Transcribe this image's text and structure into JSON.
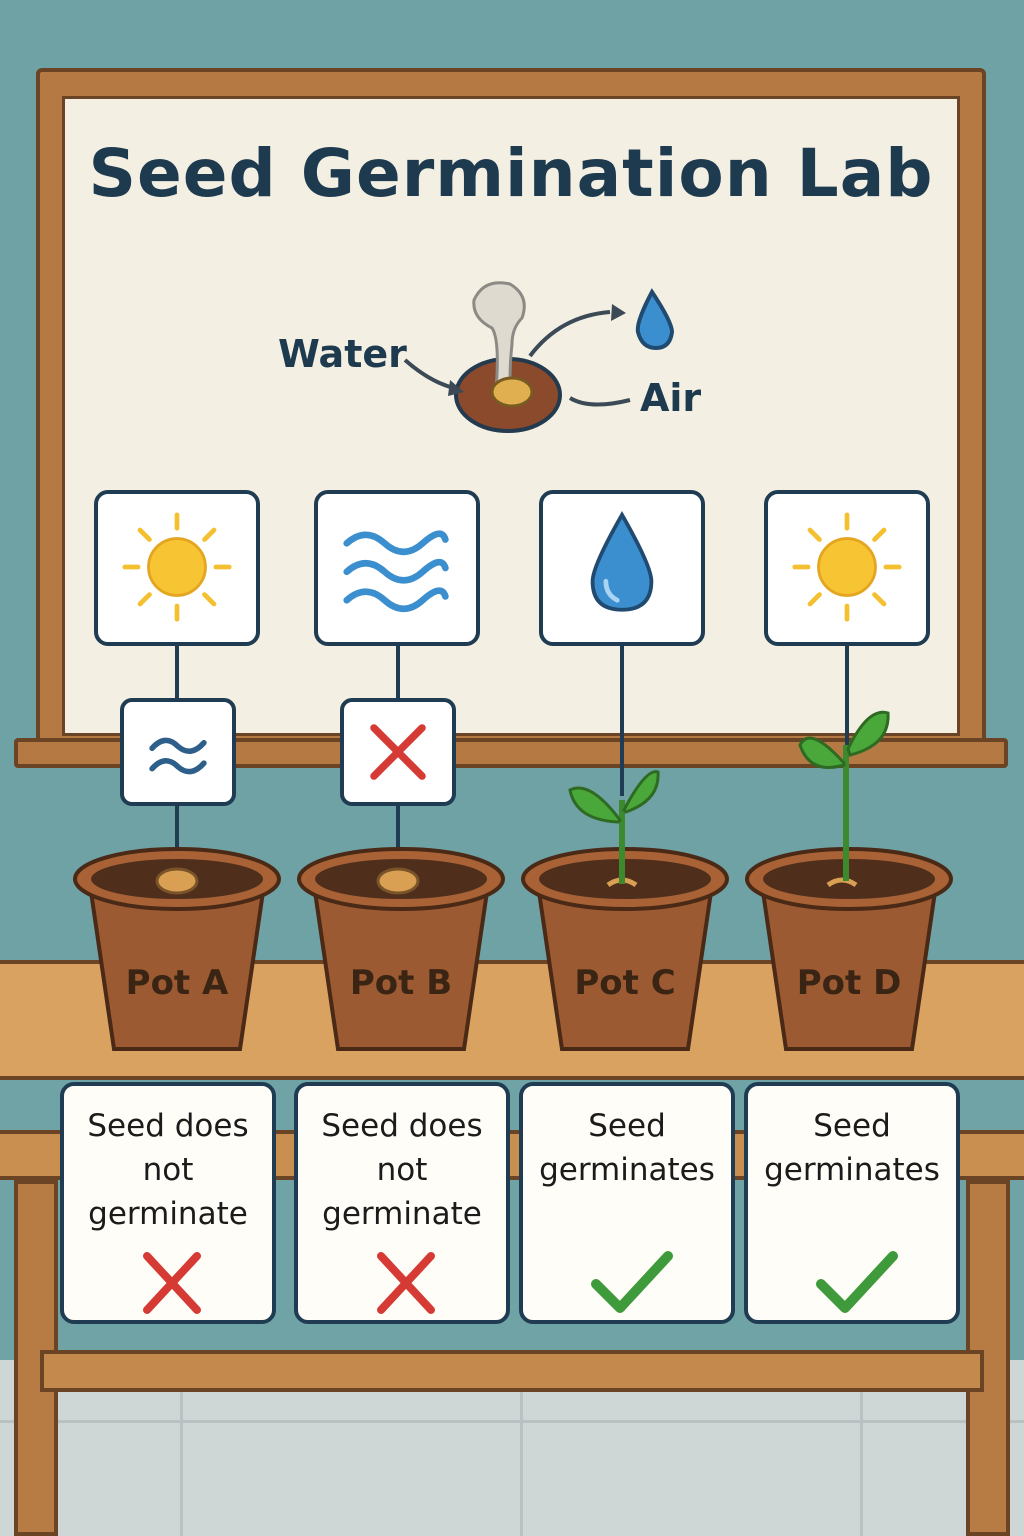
{
  "title": "Seed Germination Lab",
  "diagram": {
    "label_water": "Water",
    "label_air": "Air"
  },
  "pots": [
    {
      "label": "Pot A",
      "condition_icon": "sun-icon",
      "secondary_icon": "air-waves-icon",
      "result_lines": [
        "Seed does",
        "not",
        "germinate"
      ],
      "result_icon": "cross-icon"
    },
    {
      "label": "Pot B",
      "condition_icon": "water-waves-icon",
      "secondary_icon": "cross-icon",
      "result_lines": [
        "Seed does",
        "not",
        "germinate"
      ],
      "result_icon": "cross-icon"
    },
    {
      "label": "Pot C",
      "condition_icon": "water-drop-icon",
      "secondary_icon": "",
      "result_lines": [
        "Seed",
        "germinates"
      ],
      "result_icon": "check-icon"
    },
    {
      "label": "Pot D",
      "condition_icon": "sun-icon",
      "secondary_icon": "",
      "result_lines": [
        "Seed",
        "germinates"
      ],
      "result_icon": "check-icon"
    }
  ],
  "colors": {
    "sun": "#f4c030",
    "water": "#3c8fcf",
    "cross": "#d63a34",
    "check": "#3e9a3a",
    "leaf": "#4aa83a"
  }
}
